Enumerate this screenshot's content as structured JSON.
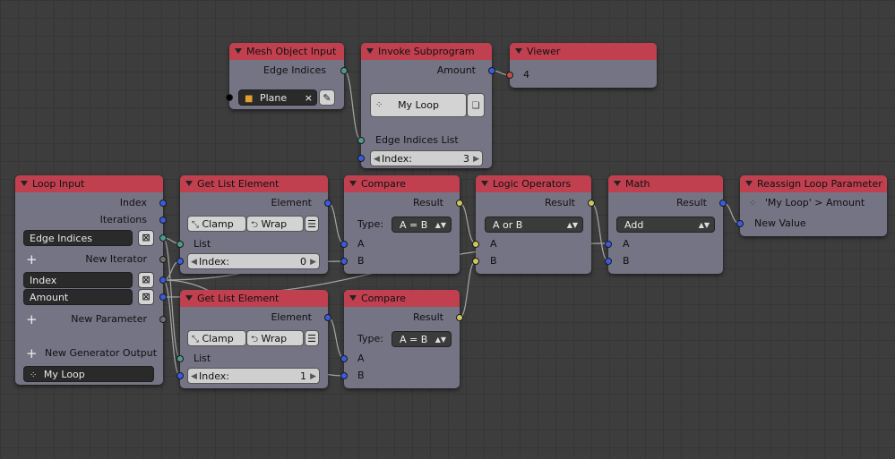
{
  "nodes": {
    "mesh_object_input": {
      "title": "Mesh Object Input",
      "output_label": "Edge Indices",
      "object_value": "Plane",
      "clear_glyph": "×",
      "eyedropper_glyph": "✎"
    },
    "invoke_subprogram": {
      "title": "Invoke Subprogram",
      "output_label": "Amount",
      "subprogram_name": "My Loop",
      "input_label": "Edge Indices List",
      "index_label": "Index:",
      "index_value": "3"
    },
    "viewer": {
      "title": "Viewer",
      "value": "4"
    },
    "loop_input": {
      "title": "Loop Input",
      "out_index": "Index",
      "out_iterations": "Iterations",
      "iterator_field": "Edge Indices",
      "new_iterator": "New Iterator",
      "param_index": "Index",
      "param_amount": "Amount",
      "new_parameter": "New Parameter",
      "new_generator": "New Generator Output",
      "loop_name": "My Loop",
      "remove_glyph": "⊠"
    },
    "get_list_element_1": {
      "title": "Get List Element",
      "output_label": "Element",
      "clamp_label": "Clamp",
      "wrap_label": "Wrap",
      "list_label": "List",
      "index_label": "Index:",
      "index_value": "0"
    },
    "get_list_element_2": {
      "title": "Get List Element",
      "output_label": "Element",
      "clamp_label": "Clamp",
      "wrap_label": "Wrap",
      "list_label": "List",
      "index_label": "Index:",
      "index_value": "1"
    },
    "compare_1": {
      "title": "Compare",
      "output_label": "Result",
      "type_label": "Type:",
      "type_value": "A = B",
      "input_a": "A",
      "input_b": "B"
    },
    "compare_2": {
      "title": "Compare",
      "output_label": "Result",
      "type_label": "Type:",
      "type_value": "A = B",
      "input_a": "A",
      "input_b": "B"
    },
    "logic_operators": {
      "title": "Logic Operators",
      "output_label": "Result",
      "operation_value": "A or B",
      "input_a": "A",
      "input_b": "B"
    },
    "math": {
      "title": "Math",
      "output_label": "Result",
      "operation_value": "Add",
      "input_a": "A",
      "input_b": "B"
    },
    "reassign_loop_parameter": {
      "title": "Reassign Loop Parameter",
      "target_label": "'My Loop' > Amount",
      "input_label": "New Value"
    }
  },
  "glyphs": {
    "up_down": "▲▼",
    "arrow_left": "◀",
    "arrow_right": "▶",
    "list_icon": "☰"
  },
  "colors": {
    "background": "#3d3d3d",
    "node_body": "#757485",
    "node_header": "#c0404f",
    "socket_blue": "#3a5be0",
    "socket_teal": "#4e9b8a",
    "socket_yellow": "#cdc65e",
    "socket_red": "#c0504a"
  }
}
